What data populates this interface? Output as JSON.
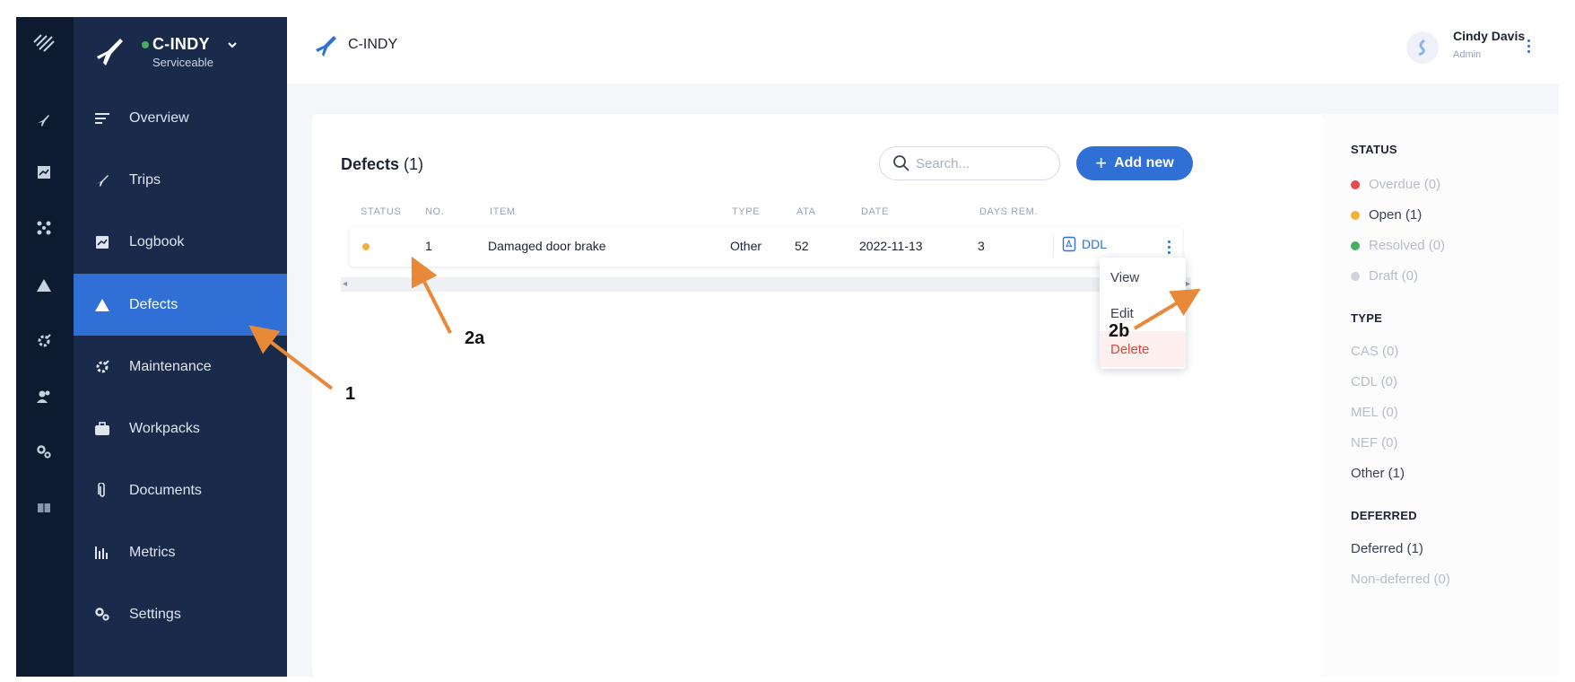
{
  "aircraft": {
    "registration": "C-INDY",
    "status": "Serviceable",
    "status_color": "#43b05c"
  },
  "sidebar": {
    "items": [
      {
        "label": "Overview",
        "icon": "overview-icon"
      },
      {
        "label": "Trips",
        "icon": "plane-icon"
      },
      {
        "label": "Logbook",
        "icon": "logbook-icon"
      },
      {
        "label": "Defects",
        "icon": "warning-icon",
        "active": true
      },
      {
        "label": "Maintenance",
        "icon": "wrench-gear-icon"
      },
      {
        "label": "Workpacks",
        "icon": "briefcase-icon"
      },
      {
        "label": "Documents",
        "icon": "paperclip-icon"
      },
      {
        "label": "Metrics",
        "icon": "bar-chart-icon"
      },
      {
        "label": "Settings",
        "icon": "gears-icon"
      }
    ]
  },
  "topbar": {
    "title": "C-INDY",
    "user": {
      "name": "Cindy Davis",
      "role": "Admin"
    }
  },
  "defects": {
    "title": "Defects",
    "count": "(1)",
    "search_placeholder": "Search...",
    "add_label": "Add new",
    "columns": [
      "STATUS",
      "NO.",
      "ITEM",
      "TYPE",
      "ATA",
      "DATE",
      "DAYS REM."
    ],
    "rows": [
      {
        "status": "Open",
        "status_color": "#f0b23a",
        "no": "1",
        "item": "Damaged door brake",
        "type": "Other",
        "ata": "52",
        "date": "2022-11-13",
        "days_rem": "3",
        "doc": "DDL"
      }
    ],
    "row_menu": [
      "View",
      "Edit",
      "Delete"
    ]
  },
  "filters": {
    "status_heading": "STATUS",
    "status": [
      {
        "label": "Overdue (0)",
        "color": "#e5484d"
      },
      {
        "label": "Open (1)",
        "color": "#f0b23a"
      },
      {
        "label": "Resolved (0)",
        "color": "#43b05c"
      },
      {
        "label": "Draft (0)",
        "color": "#cfd3da"
      }
    ],
    "type_heading": "TYPE",
    "types": [
      "CAS (0)",
      "CDL (0)",
      "MEL (0)",
      "NEF (0)",
      "Other (1)"
    ],
    "deferred_heading": "DEFERRED",
    "deferred": [
      "Deferred (1)",
      "Non-deferred (0)"
    ]
  },
  "annotations": [
    "1",
    "2a",
    "2b"
  ],
  "colors": {
    "accent": "#2f6fd6",
    "sidebar": "#1a2a4a",
    "rail": "#0e1a30",
    "arrow": "#e8893a"
  }
}
